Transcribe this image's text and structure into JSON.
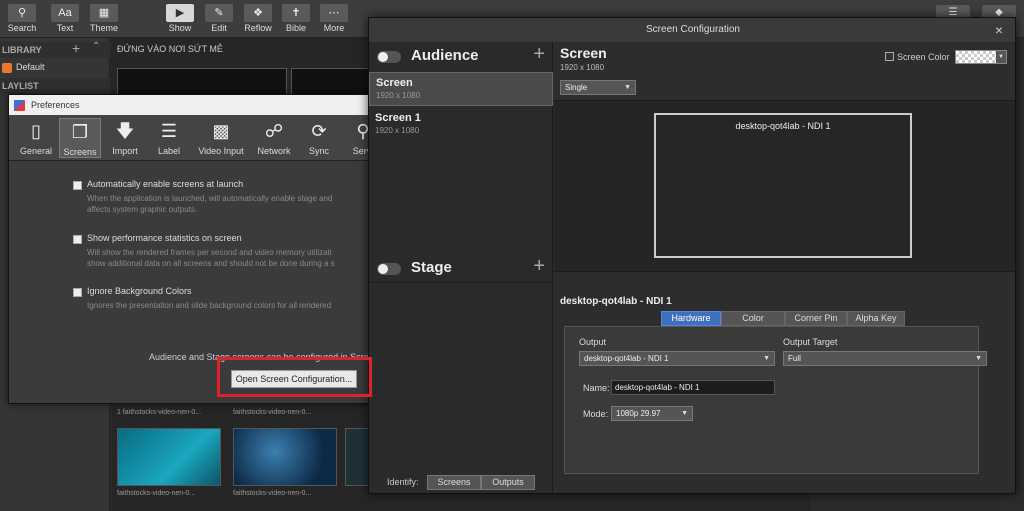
{
  "toolbar": {
    "search": "Search",
    "text": "Text",
    "theme": "Theme",
    "text_icon": "Aa",
    "show": "Show",
    "edit": "Edit",
    "reflow": "Reflow",
    "bible": "Bible",
    "more": "More"
  },
  "library": {
    "header": "LIBRARY",
    "default": "Default",
    "playlist_header": "LAYLIST"
  },
  "main": {
    "title": "ĐỨNG VÀO NƠI SỨT MẺ",
    "captions": [
      "1 faithstocks-video-nen-0...",
      "faithstocks-video-nen-0...",
      "faithstocks-video-nen-0...",
      "faithstocks-video-nen-0..."
    ]
  },
  "preferences": {
    "title": "Preferences",
    "tabs": [
      "General",
      "Screens",
      "Import",
      "Label",
      "Video Input",
      "Network",
      "Sync",
      "Servi"
    ],
    "options": [
      {
        "label": "Automatically enable screens at launch",
        "desc1": "When the application is launched, will automatically enable stage and",
        "desc2": "affects system graphic outputs."
      },
      {
        "label": "Show performance statistics on screen",
        "desc1": "Will show the rendered frames per second and video memory utilizati",
        "desc2": "show additional data on all screens and should not be done during a s"
      },
      {
        "label": "Ignore Background Colors",
        "desc1": "Ignores the presentation and slide background colors for all rendered",
        "desc2": ""
      }
    ],
    "note": "Audience and Stage screens can be configured in Scre",
    "open_button": "Open Screen Configuration..."
  },
  "screen_config": {
    "title": "Screen Configuration",
    "close": "×",
    "audience": "Audience",
    "stage": "Stage",
    "plus": "+",
    "screens": [
      {
        "name": "Screen",
        "res": "1920 x 1080"
      },
      {
        "name": "Screen 1",
        "res": "1920 x 1080"
      }
    ],
    "identify_label": "Identify:",
    "identify_screens": "Screens",
    "identify_outputs": "Outputs",
    "selected": {
      "name": "Screen",
      "res": "1920 x 1080",
      "screen_color_label": "Screen Color",
      "mode_select": "Single",
      "preview_label": "desktop-qot4lab - NDI 1",
      "output_name": "desktop-qot4lab - NDI 1",
      "tabs": [
        "Hardware",
        "Color",
        "Corner Pin",
        "Alpha Key"
      ],
      "output_label": "Output",
      "output_value": "desktop-qot4lab - NDI 1",
      "output_target_label": "Output Target",
      "output_target_value": "Full",
      "name_label": "Name:",
      "name_value": "desktop-qot4lab - NDI 1",
      "mode_label": "Mode:",
      "mode_value": "1080p 29.97"
    }
  },
  "colors": {
    "highlight": "#e0202a",
    "active_tab": "#3f6fbf",
    "library_icon": "#e8782a"
  }
}
